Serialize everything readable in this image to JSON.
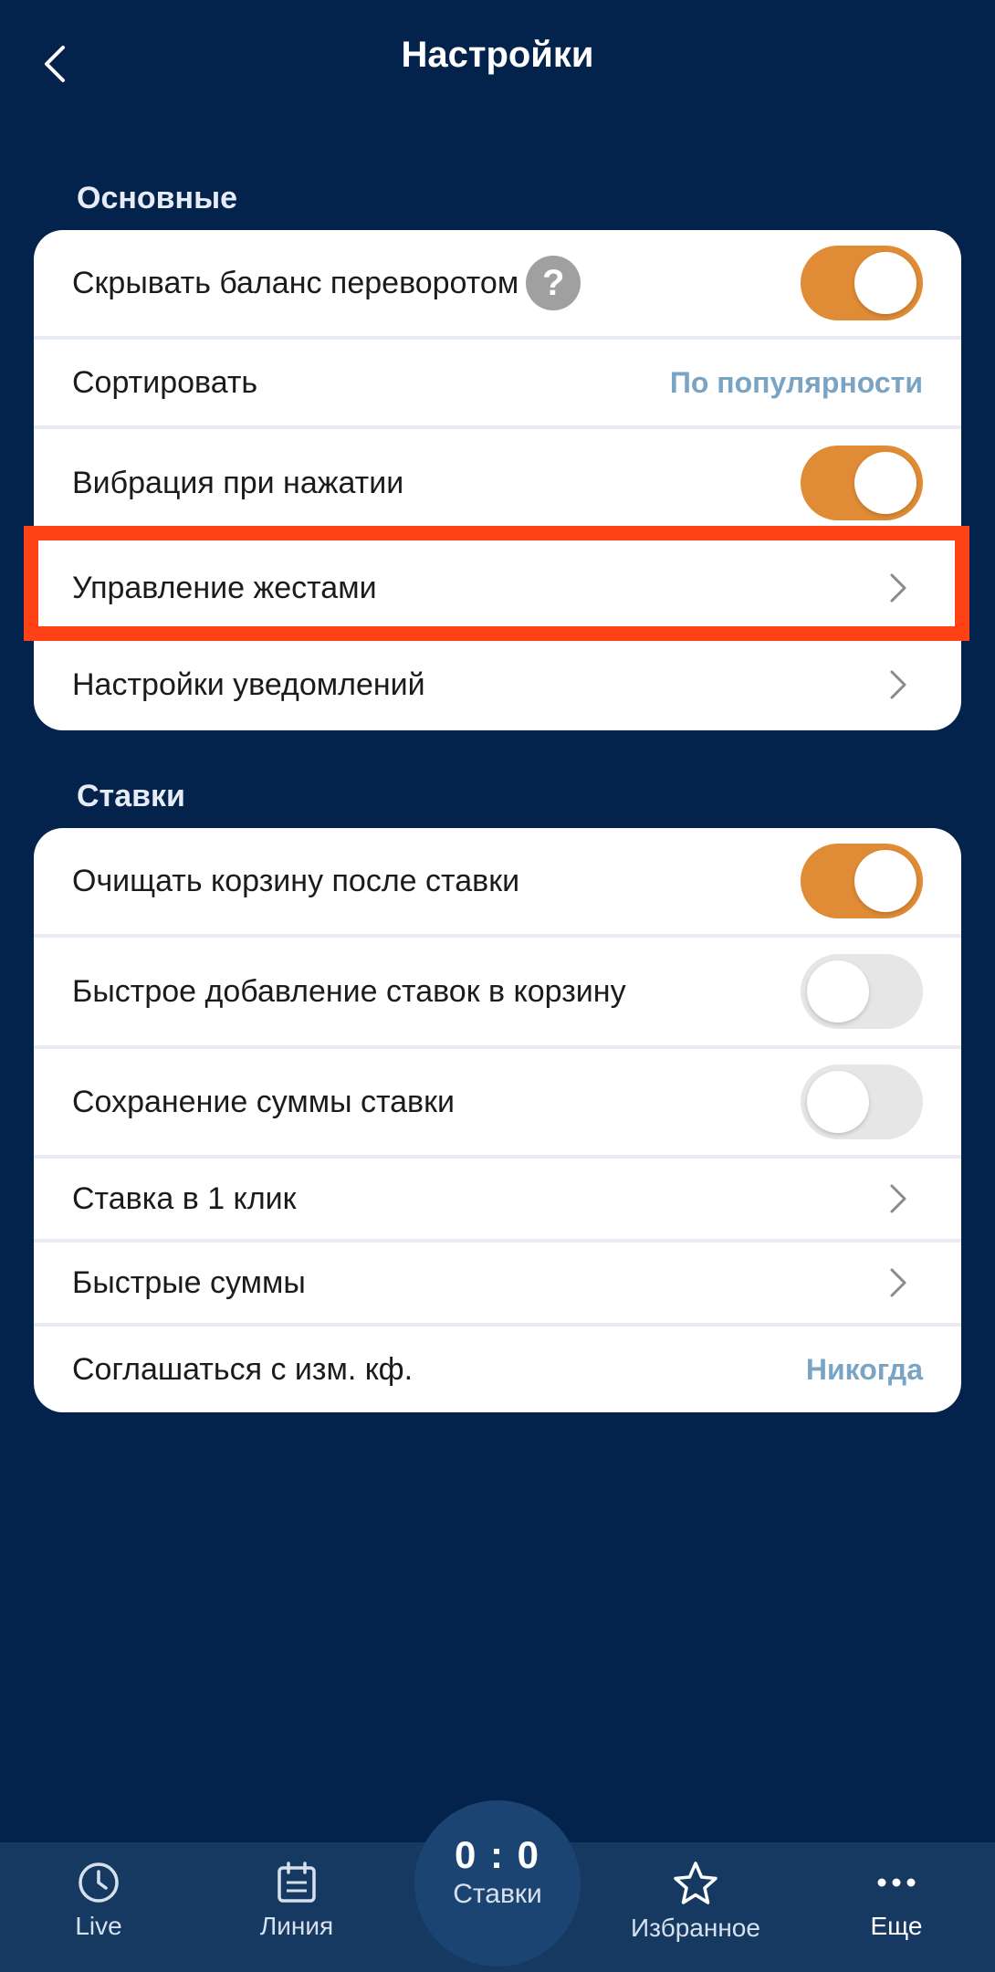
{
  "header": {
    "title": "Настройки",
    "back_icon": "chevron-left-icon"
  },
  "sections": {
    "main": {
      "title": "Основные",
      "rows": [
        {
          "label": "Скрывать баланс переворотом",
          "control": "toggle",
          "on": true,
          "help_icon": "?"
        },
        {
          "label": "Сортировать",
          "control": "value",
          "value": "По популярности"
        },
        {
          "label": "Вибрация при нажатии",
          "control": "toggle",
          "on": true
        },
        {
          "label": "Управление жестами",
          "control": "chevron"
        },
        {
          "label": "Настройки уведомлений",
          "control": "chevron"
        }
      ]
    },
    "bets": {
      "title": "Ставки",
      "rows": [
        {
          "label": "Очищать корзину после ставки",
          "control": "toggle",
          "on": true
        },
        {
          "label": "Быстрое добавление ставок в корзину",
          "control": "toggle",
          "on": false
        },
        {
          "label": "Сохранение суммы ставки",
          "control": "toggle",
          "on": false
        },
        {
          "label": "Ставка в 1 клик",
          "control": "chevron"
        },
        {
          "label": "Быстрые суммы",
          "control": "chevron"
        },
        {
          "label": "Соглашаться с изм. кф.",
          "control": "value",
          "value": "Никогда"
        }
      ]
    }
  },
  "bottom_nav": {
    "live": {
      "label": "Live",
      "icon": "clock-icon"
    },
    "line": {
      "label": "Линия",
      "icon": "calendar-icon"
    },
    "bets": {
      "score": "0 : 0",
      "label": "Ставки"
    },
    "favorites": {
      "label": "Избранное",
      "icon": "star-icon"
    },
    "more": {
      "label": "Еще",
      "icon": "more-dots-icon"
    }
  },
  "colors": {
    "background": "#03234d",
    "toggle_on": "#e08b35",
    "toggle_off": "#e6e6e6",
    "value_text": "#7aa4c4",
    "highlight": "#ff4116",
    "nav_bg": "#163962"
  }
}
